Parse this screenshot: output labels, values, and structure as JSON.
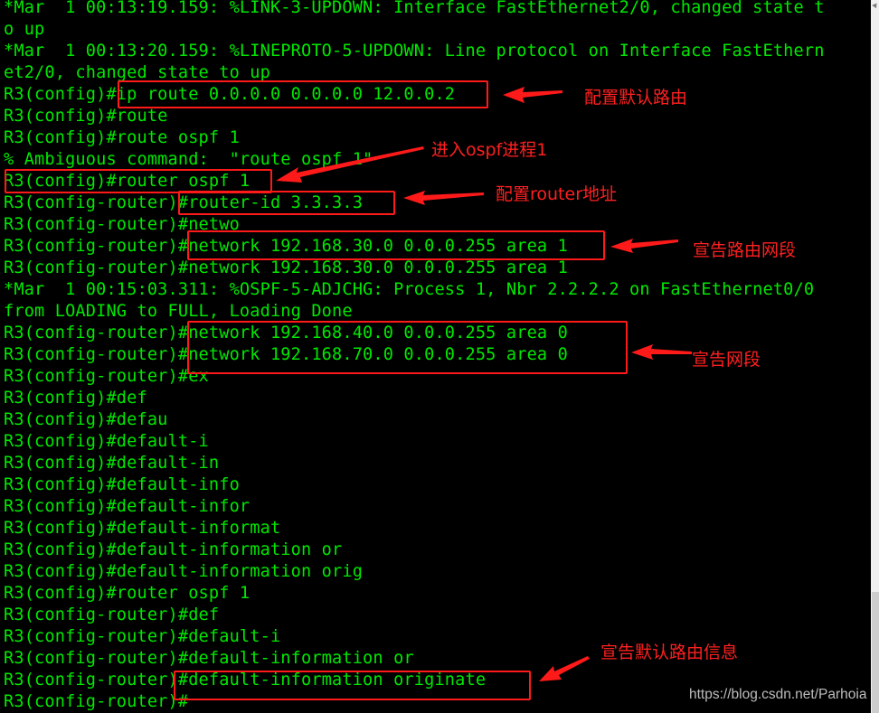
{
  "terminal": {
    "lines": [
      "*Mar  1 00:13:19.159: %LINK-3-UPDOWN: Interface FastEthernet2/0, changed state t",
      "o up",
      "*Mar  1 00:13:20.159: %LINEPROTO-5-UPDOWN: Line protocol on Interface FastEthern",
      "et2/0, changed state to up",
      "R3(config)#ip route 0.0.0.0 0.0.0.0 12.0.0.2",
      "R3(config)#route",
      "R3(config)#route ospf 1",
      "% Ambiguous command:  \"route ospf 1\"",
      "R3(config)#router ospf 1",
      "R3(config-router)#router-id 3.3.3.3",
      "R3(config-router)#netwo",
      "R3(config-router)#network 192.168.30.0 0.0.0.255 area 1",
      "R3(config-router)#network 192.168.30.0 0.0.0.255 area 1",
      "*Mar  1 00:15:03.311: %OSPF-5-ADJCHG: Process 1, Nbr 2.2.2.2 on FastEthernet0/0",
      "from LOADING to FULL, Loading Done",
      "R3(config-router)#network 192.168.40.0 0.0.0.255 area 0",
      "R3(config-router)#network 192.168.70.0 0.0.0.255 area 0",
      "R3(config-router)#ex",
      "R3(config)#def",
      "R3(config)#defau",
      "R3(config)#default-i",
      "R3(config)#default-in",
      "R3(config)#default-info",
      "R3(config)#default-infor",
      "R3(config)#default-informat",
      "R3(config)#default-information or",
      "R3(config)#default-information orig",
      "R3(config)#router ospf 1",
      "R3(config-router)#def",
      "R3(config-router)#default-i",
      "R3(config-router)#default-information or",
      "R3(config-router)#default-information originate",
      "R3(config-router)#"
    ]
  },
  "annotations": {
    "default_route": "配置默认路由",
    "enter_ospf": "进入ospf进程1",
    "router_id": "配置router地址",
    "advertise_route_segment": "宣告路由网段",
    "advertise_segment": "宣告网段",
    "advertise_default_info": "宣告默认路由信息"
  },
  "watermark": "https://blog.csdn.net/Parhoia",
  "colors": {
    "terminal_bg": "#000000",
    "terminal_text": "#00e800",
    "annotation": "#ff2020",
    "watermark": "#bdbdbd"
  }
}
